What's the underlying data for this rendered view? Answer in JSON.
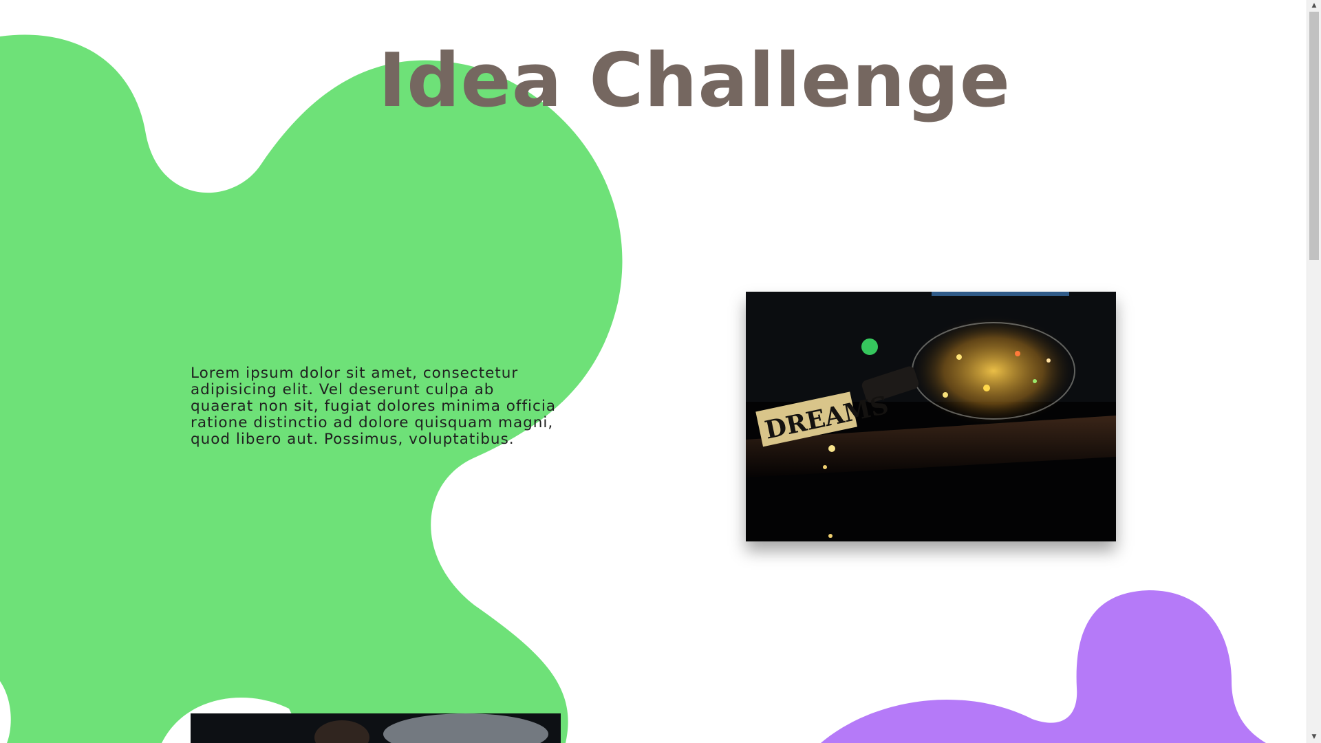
{
  "page": {
    "title": "Idea Challenge",
    "intro_text": "Lorem ipsum dolor sit amet, consectetur adipisicing elit. Vel deserunt culpa ab quaerat non sit, fugiat dolores minima officia ratione distinctio ad dolore quisquam magni, quod libero aut. Possimus, voluptatibus.",
    "photo_sign_text": "DREAMS"
  },
  "colors": {
    "title": "#756760",
    "text": "#1f1f1f",
    "blob_green": "#6ee178",
    "blob_purple": "#b57af8",
    "background": "#ffffff"
  },
  "scrollbar": {
    "up_arrow": "▲",
    "down_arrow": "▼"
  },
  "icons": {
    "scroll_up": "triangle-up-icon",
    "scroll_down": "triangle-down-icon"
  }
}
